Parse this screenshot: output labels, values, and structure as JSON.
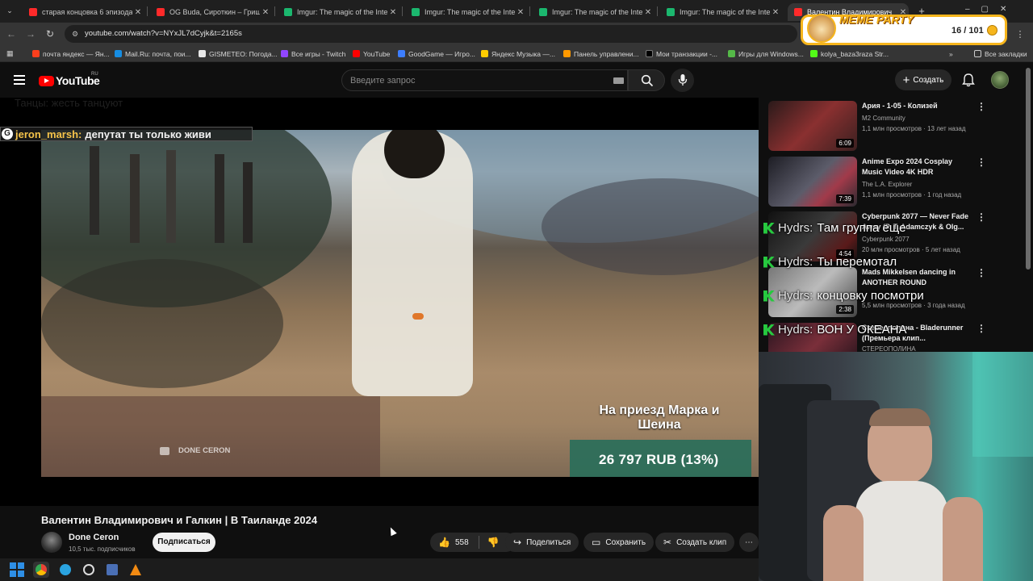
{
  "tabs": [
    {
      "title": "старая концовка 6 эпизода -",
      "color": "#ff2a2a"
    },
    {
      "title": "OG Buda, Сироткин – Гриша С",
      "color": "#ff2a2a"
    },
    {
      "title": "Imgur: The magic of the Intern",
      "color": "#1bb76e"
    },
    {
      "title": "Imgur: The magic of the Intern",
      "color": "#1bb76e"
    },
    {
      "title": "Imgur: The magic of the Intern",
      "color": "#1bb76e"
    },
    {
      "title": "Imgur: The magic of the Intern",
      "color": "#1bb76e"
    },
    {
      "title": "Валентин Владимирович",
      "color": "#ff2a2a"
    }
  ],
  "address": {
    "url": "youtube.com/watch?v=NYxJL7dCyjk&t=2165s"
  },
  "bookmarks": [
    {
      "label": "почта яндекс — Ян...",
      "color": "#fc3f1d"
    },
    {
      "label": "Mail.Ru: почта, пои...",
      "color": "#168de2"
    },
    {
      "label": "GISMETEO: Погода...",
      "color": "#ffffff"
    },
    {
      "label": "Все игры - Twitch",
      "color": "#9146ff"
    },
    {
      "label": "YouTube",
      "color": "#ff0000"
    },
    {
      "label": "GoodGame — Игро...",
      "color": "#3d7eff"
    },
    {
      "label": "Яндекс Музыка —...",
      "color": "#ffcc00"
    },
    {
      "label": "Панель управлени...",
      "color": "#ff9900"
    },
    {
      "label": "Мои транзакции -...",
      "color": "#222222"
    },
    {
      "label": "Игры для Windows...",
      "color": "#55b948"
    },
    {
      "label": "kolya_baza3raza Str...",
      "color": "#53fc18"
    }
  ],
  "bookmarks_all": "Все закладки",
  "header": {
    "logo_text": "YouTube",
    "region": "RU",
    "search_placeholder": "Введите запрос",
    "create_label": "Создать"
  },
  "player": {
    "ghost_text": "Танцы: жесть танцуют",
    "chat_user": "jeron_marsh:",
    "chat_message": "депутат ты только живи",
    "caption": "На приезд Марка и Шеина",
    "donation": "26 797 RUB (13%)",
    "watermark": "DONE CERON"
  },
  "video": {
    "title": "Валентин Владимирович и Галкин | В Таиланде 2024",
    "channel": "Done Ceron",
    "subscribers": "10,5 тыс. подписчиков",
    "subscribe_label": "Подписаться",
    "likes": "558",
    "share_label": "Поделиться",
    "save_label": "Сохранить",
    "clip_label": "Создать клип"
  },
  "recommendations": [
    {
      "title": "Ария - 1-05 - Колизей",
      "channel": "M2 Community",
      "meta": "1,1 млн просмотров · 13 лет назад",
      "duration": "6:09",
      "thumb_color": "#6a2a2a"
    },
    {
      "title": "Anime Expo 2024 Cosplay Music Video 4K HDR",
      "channel": "The L.A. Explorer",
      "meta": "1,1 млн просмотров · 1 год назад",
      "duration": "7:39",
      "thumb_color": "#3a3a44"
    },
    {
      "title": "Cyberpunk 2077 — Never Fade Away (P. T. Adamczyk & Olg...",
      "channel": "Cyberpunk 2077",
      "meta": "20 млн просмотров · 5 лет назад",
      "duration": "4:54",
      "thumb_color": "#2a2a2a"
    },
    {
      "title": "Mads Mikkelsen dancing in ANOTHER ROUND",
      "channel": "",
      "meta": "5,5 млн просмотров · 3 года назад",
      "duration": "2:38",
      "thumb_color": "#555a60"
    },
    {
      "title": "Стереополина - Bladerunner (Премьера клип...",
      "channel": "СТЕРЕОПОЛИНА",
      "meta": "",
      "duration": "",
      "thumb_color": "#3a1f2a"
    }
  ],
  "overlay_chat": [
    {
      "user": "Hydrs:",
      "message": "Там группа еще"
    },
    {
      "user": "Hydrs:",
      "message": "Ты перемотал"
    },
    {
      "user": "Hydrs:",
      "message": "концовку посмотри"
    },
    {
      "user": "Hydrs:",
      "message": "ВОН У ОКЕАНА"
    }
  ],
  "meme_party": {
    "title": "MEME PARTY",
    "count": "16 / 101"
  }
}
